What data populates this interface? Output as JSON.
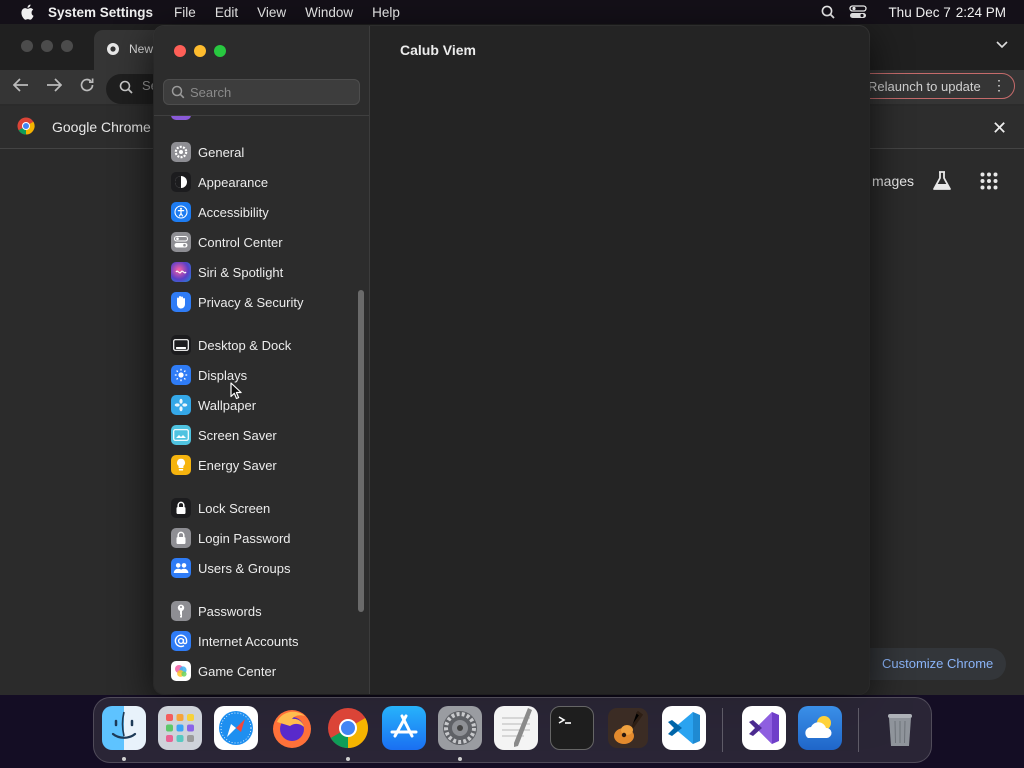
{
  "menubar": {
    "app_name": "System Settings",
    "menus": [
      "File",
      "Edit",
      "View",
      "Window",
      "Help"
    ],
    "day_date": "Thu Dec 7",
    "time": "2:24 PM"
  },
  "chrome": {
    "tab_title": "New",
    "omnibox_text": "Se",
    "relaunch_label": "Relaunch to update",
    "infobar_text": "Google Chrome i",
    "images_link": "mages",
    "customize_label": "Customize Chrome"
  },
  "settings": {
    "search_placeholder": "Search",
    "title": "Calub Viem",
    "sidebar": [
      {
        "label": "General",
        "icon": "gear-icon",
        "color": "#8e8e93"
      },
      {
        "label": "Appearance",
        "icon": "appearance-icon",
        "color": "#1c1c1e"
      },
      {
        "label": "Accessibility",
        "icon": "accessibility-icon",
        "color": "#1d7cf2"
      },
      {
        "label": "Control Center",
        "icon": "control-center-icon",
        "color": "#8e8e93"
      },
      {
        "label": "Siri & Spotlight",
        "icon": "siri-icon",
        "color": "#5a3fc7"
      },
      {
        "label": "Privacy & Security",
        "icon": "hand-icon",
        "color": "#2f7cf6"
      },
      {
        "label": "Desktop & Dock",
        "icon": "dock-icon",
        "color": "#1c1c1e"
      },
      {
        "label": "Displays",
        "icon": "sun-icon",
        "color": "#2f7cf6"
      },
      {
        "label": "Wallpaper",
        "icon": "flower-icon",
        "color": "#35a8e8"
      },
      {
        "label": "Screen Saver",
        "icon": "screensaver-icon",
        "color": "#4fc3e0"
      },
      {
        "label": "Energy Saver",
        "icon": "bulb-icon",
        "color": "#f6b40e"
      },
      {
        "label": "Lock Screen",
        "icon": "lock-icon",
        "color": "#1c1c1e"
      },
      {
        "label": "Login Password",
        "icon": "lock-icon",
        "color": "#8e8e93"
      },
      {
        "label": "Users & Groups",
        "icon": "users-icon",
        "color": "#2f7cf6"
      },
      {
        "label": "Passwords",
        "icon": "key-icon",
        "color": "#8e8e93"
      },
      {
        "label": "Internet Accounts",
        "icon": "at-icon",
        "color": "#2f7cf6"
      },
      {
        "label": "Game Center",
        "icon": "game-center-icon",
        "color": "#ffffff"
      }
    ]
  },
  "dock": {
    "apps": [
      {
        "name": "Finder",
        "icon": "finder-icon",
        "color": "#3b9cf5",
        "running": true
      },
      {
        "name": "Launchpad",
        "icon": "launchpad-icon",
        "color": "#c9cdd6",
        "running": false
      },
      {
        "name": "Safari",
        "icon": "safari-icon",
        "color": "#ffffff",
        "running": false
      },
      {
        "name": "Firefox",
        "icon": "firefox-icon",
        "color": "#ff7139",
        "running": false
      },
      {
        "name": "Google Chrome",
        "icon": "chrome-icon",
        "color": "#ffffff",
        "running": true
      },
      {
        "name": "App Store",
        "icon": "app-store-icon",
        "color": "#1a8cf7",
        "running": false
      },
      {
        "name": "System Settings",
        "icon": "system-settings-icon",
        "color": "#8e8e93",
        "running": true
      },
      {
        "name": "TextEdit",
        "icon": "textedit-icon",
        "color": "#f2f2f2",
        "running": false
      },
      {
        "name": "Terminal",
        "icon": "terminal-icon",
        "color": "#1e1e1e",
        "running": false
      },
      {
        "name": "GarageBand",
        "icon": "garageband-icon",
        "color": "#3a2a20",
        "running": false
      },
      {
        "name": "Visual Studio Code",
        "icon": "vscode-icon",
        "color": "#ffffff",
        "running": false
      },
      {
        "name": "Visual Studio",
        "icon": "visual-studio-icon",
        "color": "#ffffff",
        "running": false
      },
      {
        "name": "Weather",
        "icon": "weather-icon",
        "color": "#2f86e8",
        "running": false
      },
      {
        "name": "Trash",
        "icon": "trash-icon",
        "color": "#9ea3aa",
        "running": false
      }
    ]
  }
}
